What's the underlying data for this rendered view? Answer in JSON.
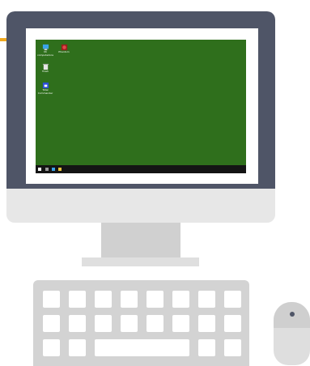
{
  "desktop": {
    "background_color": "#2f6f1c",
    "icons": [
      {
        "name": "computer-icon",
        "label": "Mi computadora"
      },
      {
        "name": "app-icon",
        "label": "Phantom"
      },
      {
        "name": "recycle-bin-icon",
        "label": "Trash"
      },
      {
        "name": "file-icon",
        "label": "Total Commander"
      }
    ]
  },
  "taskbar": {
    "background_color": "#141414",
    "items": [
      "start-icon",
      "search-icon",
      "task-view-icon",
      "folder-icon"
    ]
  },
  "colors": {
    "bezel": "#4f5567",
    "accent": "#f0a81e",
    "keyboard": "#d3d3d3",
    "mouse": "#dedede"
  }
}
